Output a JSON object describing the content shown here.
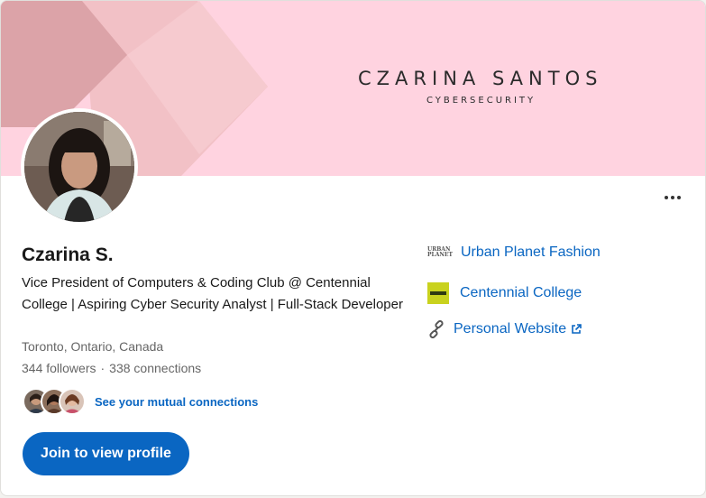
{
  "banner": {
    "name": "CZARINA SANTOS",
    "subtitle": "CYBERSECURITY",
    "background_color": "#ffd3e0"
  },
  "profile": {
    "name": "Czarina S.",
    "headline": "Vice President of Computers & Coding Club @ Centennial College | Aspiring Cyber Security Analyst | Full-Stack Developer",
    "location": "Toronto, Ontario, Canada",
    "followers": "344 followers",
    "separator": "·",
    "connections": "338 connections"
  },
  "mutual": {
    "link_text": "See your mutual connections"
  },
  "actions": {
    "join_label": "Join to view profile",
    "more_icon": "more-horizontal-icon"
  },
  "sidebar_links": {
    "company": {
      "label": "Urban Planet Fashion",
      "logo_text_1": "URBAN",
      "logo_text_2": "PLANET"
    },
    "school": {
      "label": "Centennial College"
    },
    "website": {
      "label": "Personal Website",
      "icon": "link-icon",
      "external_icon": "external-link-icon"
    }
  },
  "colors": {
    "accent": "#0a66c2",
    "secondary_text": "#666666",
    "primary_text": "#191919"
  }
}
